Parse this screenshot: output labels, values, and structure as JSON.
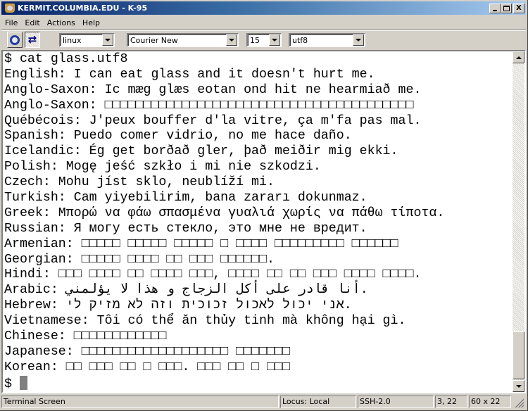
{
  "window": {
    "title": "KERMIT.COLUMBIA.EDU - K-95",
    "app_icon": "crown-icon",
    "controls": {
      "minimize": "minimize",
      "maximize": "maximize",
      "close": "X"
    }
  },
  "menubar": {
    "items": [
      {
        "label": "File"
      },
      {
        "label": "Edit"
      },
      {
        "label": "Actions"
      },
      {
        "label": "Help"
      }
    ]
  },
  "toolbar": {
    "buttons": [
      {
        "icon": "gear-icon",
        "state": "raised"
      },
      {
        "icon": "exchange-arrows-icon",
        "arrows": "⇄",
        "state": "pressed"
      }
    ],
    "terminal_type": {
      "value": "linux"
    },
    "font": {
      "value": "Courier New"
    },
    "font_size": {
      "value": "15"
    },
    "charset": {
      "value": "utf8"
    }
  },
  "terminal": {
    "lines": [
      "$ cat glass.utf8",
      "English: I can eat glass and it doesn't hurt me.",
      "Anglo-Saxon: Ic mæg glæs eotan ond hit ne hearmiað me.",
      "Anglo-Saxon: □□□□□□□□□□□□□□□□□□□□□□□□□□□□□□□□□□□□□□□□",
      "Québécois: J'peux bouffer d'la vitre, ça m'fa pas mal.",
      "Spanish: Puedo comer vidrio, no me hace daño.",
      "Icelandic: Ég get borðað gler, það meiðir mig ekki.",
      "Polish: Mogę jeść szkło i mi nie szkodzi.",
      "Czech: Mohu jíst sklo, neublíží mi.",
      "Turkish: Cam yiyebilirim, bana zararı dokunmaz.",
      "Greek: Μπορώ να φάω σπασμένα γυαλιά χωρίς να πάθω τίποτα.",
      "Russian: Я могу есть стекло, это мне не вредит.",
      "Armenian: □□□□□ □□□□□ □□□□□ □ □□□□ □□□□□□□□□ □□□□□□",
      "Georgian: □□□□□ □□□□ □□ □□□ □□□□□□.",
      "Hindi: □□□ □□□□ □□ □□□□ □□□, □□□□ □□ □□ □□□ □□□□ □□□□.",
      "Arabic: أنا قادر على أكل الزجاج و هذا لا يؤلمني.",
      "Hebrew: אני יכול לאכול זכוכית וזה לא מזיק לי.",
      "Vietnamese: Tôi có thể ăn thủy tinh mà không hại gì.",
      "Chinese: □□□□□□□□□□□□",
      "Japanese: □□□□□□□□□□□□□□□□□□□ □□□□□□□",
      "Korean: □□ □□□ □□ □ □□□. □□□ □□ □ □□□"
    ],
    "prompt": "$ ",
    "cursor_color": "#808080"
  },
  "statusbar": {
    "screen": "Terminal Screen",
    "locus": "Locus: Local",
    "protocol": "SSH-2.0",
    "cursor_pos": "3, 22",
    "dimensions": "60 x 22"
  },
  "colors": {
    "titlebar_start": "#0a246a",
    "titlebar_end": "#a6caf0",
    "chrome": "#d4d0c8",
    "terminal_bg": "#ffffff",
    "terminal_fg": "#000000"
  }
}
